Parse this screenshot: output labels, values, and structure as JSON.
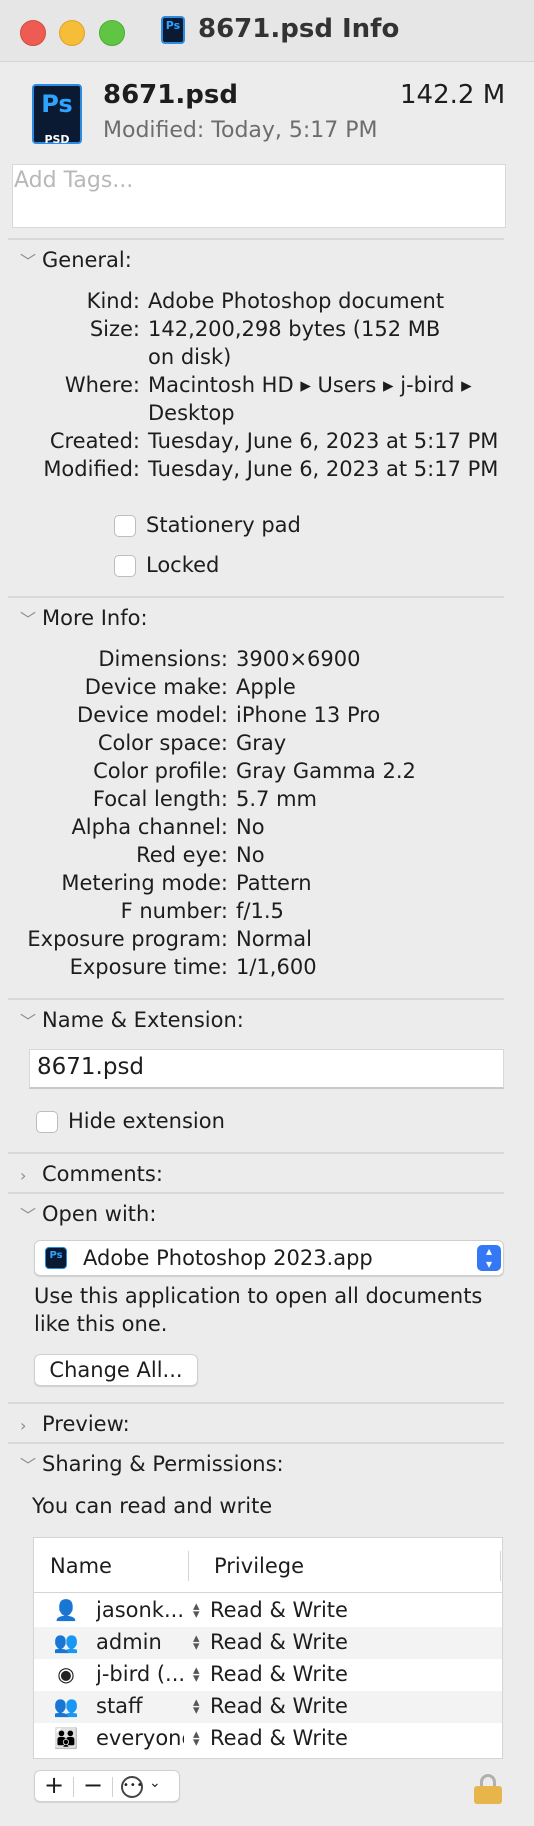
{
  "window": {
    "title": "8671.psd Info"
  },
  "header": {
    "name": "8671.psd",
    "modified": "Modified: Today, 5:17 PM",
    "size": "142.2 M",
    "icon": "photoshop-psd-icon",
    "icon_text": "Ps",
    "icon_sub": "PSD"
  },
  "tags": {
    "placeholder": "Add Tags..."
  },
  "general": {
    "title": "General:",
    "kind_label": "Kind:",
    "kind": "Adobe Photoshop document",
    "size_label": "Size:",
    "size_line1": "142,200,298 bytes (152 MB",
    "size_line2": "on disk)",
    "where_label": "Where:",
    "where_line1": "Macintosh HD ▸ Users ▸ j-bird ▸",
    "where_line2": "Desktop",
    "created_label": "Created:",
    "created": "Tuesday, June 6, 2023 at 5:17 PM",
    "modified_label": "Modified:",
    "modified": "Tuesday, June 6, 2023 at 5:17 PM",
    "stationery": "Stationery pad",
    "locked": "Locked"
  },
  "more_info": {
    "title": "More Info:",
    "items": [
      {
        "label": "Dimensions:",
        "value": "3900×6900"
      },
      {
        "label": "Device make:",
        "value": "Apple"
      },
      {
        "label": "Device model:",
        "value": "iPhone 13 Pro"
      },
      {
        "label": "Color space:",
        "value": "Gray"
      },
      {
        "label": "Color profile:",
        "value": "Gray Gamma 2.2"
      },
      {
        "label": "Focal length:",
        "value": "5.7 mm"
      },
      {
        "label": "Alpha channel:",
        "value": "No"
      },
      {
        "label": "Red eye:",
        "value": "No"
      },
      {
        "label": "Metering mode:",
        "value": "Pattern"
      },
      {
        "label": "F number:",
        "value": "f/1.5"
      },
      {
        "label": "Exposure program:",
        "value": "Normal"
      },
      {
        "label": "Exposure time:",
        "value": "1/1,600"
      }
    ]
  },
  "name_ext": {
    "title": "Name & Extension:",
    "filename": "8671.psd",
    "hide_ext": "Hide extension"
  },
  "comments": {
    "title": "Comments:"
  },
  "open_with": {
    "title": "Open with:",
    "app": "Adobe Photoshop 2023.app",
    "desc_line1": "Use this application to open all documents",
    "desc_line2": "like this one.",
    "change_all": "Change All..."
  },
  "preview": {
    "title": "Preview:"
  },
  "sharing": {
    "title": "Sharing & Permissions:",
    "status": "You can read and write",
    "col_name": "Name",
    "col_priv": "Privilege",
    "rows": [
      {
        "name": "jasonk...",
        "priv": "Read & Write",
        "icon": "user-icon"
      },
      {
        "name": "admin",
        "priv": "Read & Write",
        "icon": "group-icon"
      },
      {
        "name": "j-bird (...",
        "priv": "Read & Write",
        "icon": "user-circle-icon"
      },
      {
        "name": "staff",
        "priv": "Read & Write",
        "icon": "group-icon"
      },
      {
        "name": "everyone",
        "priv": "Read & Write",
        "icon": "everyone-icon"
      }
    ]
  },
  "colors": {
    "accent": "#3478f6",
    "ps_dark": "#0b1a33",
    "ps_blue": "#2fa4ff"
  }
}
